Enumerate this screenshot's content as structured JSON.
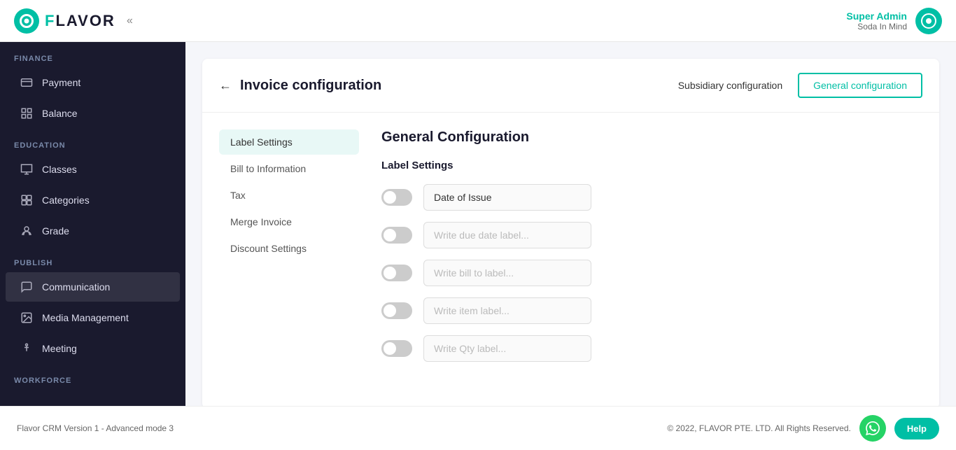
{
  "app": {
    "logo_text": "FLAVOR",
    "collapse_icon": "«"
  },
  "user": {
    "name": "Super Admin",
    "company": "Soda In Mind"
  },
  "sidebar": {
    "sections": [
      {
        "label": "FINANCE",
        "items": [
          {
            "id": "payment",
            "label": "Payment",
            "icon": "credit-card"
          },
          {
            "id": "balance",
            "label": "Balance",
            "icon": "balance"
          }
        ]
      },
      {
        "label": "EDUCATION",
        "items": [
          {
            "id": "classes",
            "label": "Classes",
            "icon": "classes"
          },
          {
            "id": "categories",
            "label": "Categories",
            "icon": "categories"
          },
          {
            "id": "grade",
            "label": "Grade",
            "icon": "grade"
          }
        ]
      },
      {
        "label": "PUBLISH",
        "items": [
          {
            "id": "communication",
            "label": "Communication",
            "icon": "communication",
            "active": true
          },
          {
            "id": "media-management",
            "label": "Media Management",
            "icon": "media"
          },
          {
            "id": "meeting",
            "label": "Meeting",
            "icon": "meeting"
          }
        ]
      },
      {
        "label": "WORKFORCE",
        "items": []
      }
    ]
  },
  "page": {
    "back_label": "←",
    "title": "Invoice configuration",
    "tabs": [
      {
        "id": "subsidiary",
        "label": "Subsidiary configuration",
        "active": false
      },
      {
        "id": "general",
        "label": "General configuration",
        "active": true
      }
    ],
    "nav_items": [
      {
        "id": "label-settings",
        "label": "Label Settings",
        "active": true
      },
      {
        "id": "bill-to-information",
        "label": "Bill to Information",
        "active": false
      },
      {
        "id": "tax",
        "label": "Tax",
        "active": false
      },
      {
        "id": "merge-invoice",
        "label": "Merge Invoice",
        "active": false
      },
      {
        "id": "discount-settings",
        "label": "Discount Settings",
        "active": false
      }
    ],
    "content_title": "General Configuration",
    "section_label": "Label Settings",
    "toggle_rows": [
      {
        "id": "date-of-issue",
        "on": false,
        "value": "Date of Issue",
        "placeholder": ""
      },
      {
        "id": "due-date",
        "on": false,
        "value": "",
        "placeholder": "Write due date label..."
      },
      {
        "id": "bill-to",
        "on": false,
        "value": "",
        "placeholder": "Write bill to label..."
      },
      {
        "id": "item",
        "on": false,
        "value": "",
        "placeholder": "Write item label..."
      },
      {
        "id": "qty",
        "on": false,
        "value": "",
        "placeholder": "Write Qty label..."
      }
    ]
  },
  "footer": {
    "version_text": "Flavor CRM Version 1 - Advanced mode 3",
    "copyright_text": "© 2022, FLAVOR PTE. LTD. All Rights Reserved.",
    "help_label": "Help"
  }
}
